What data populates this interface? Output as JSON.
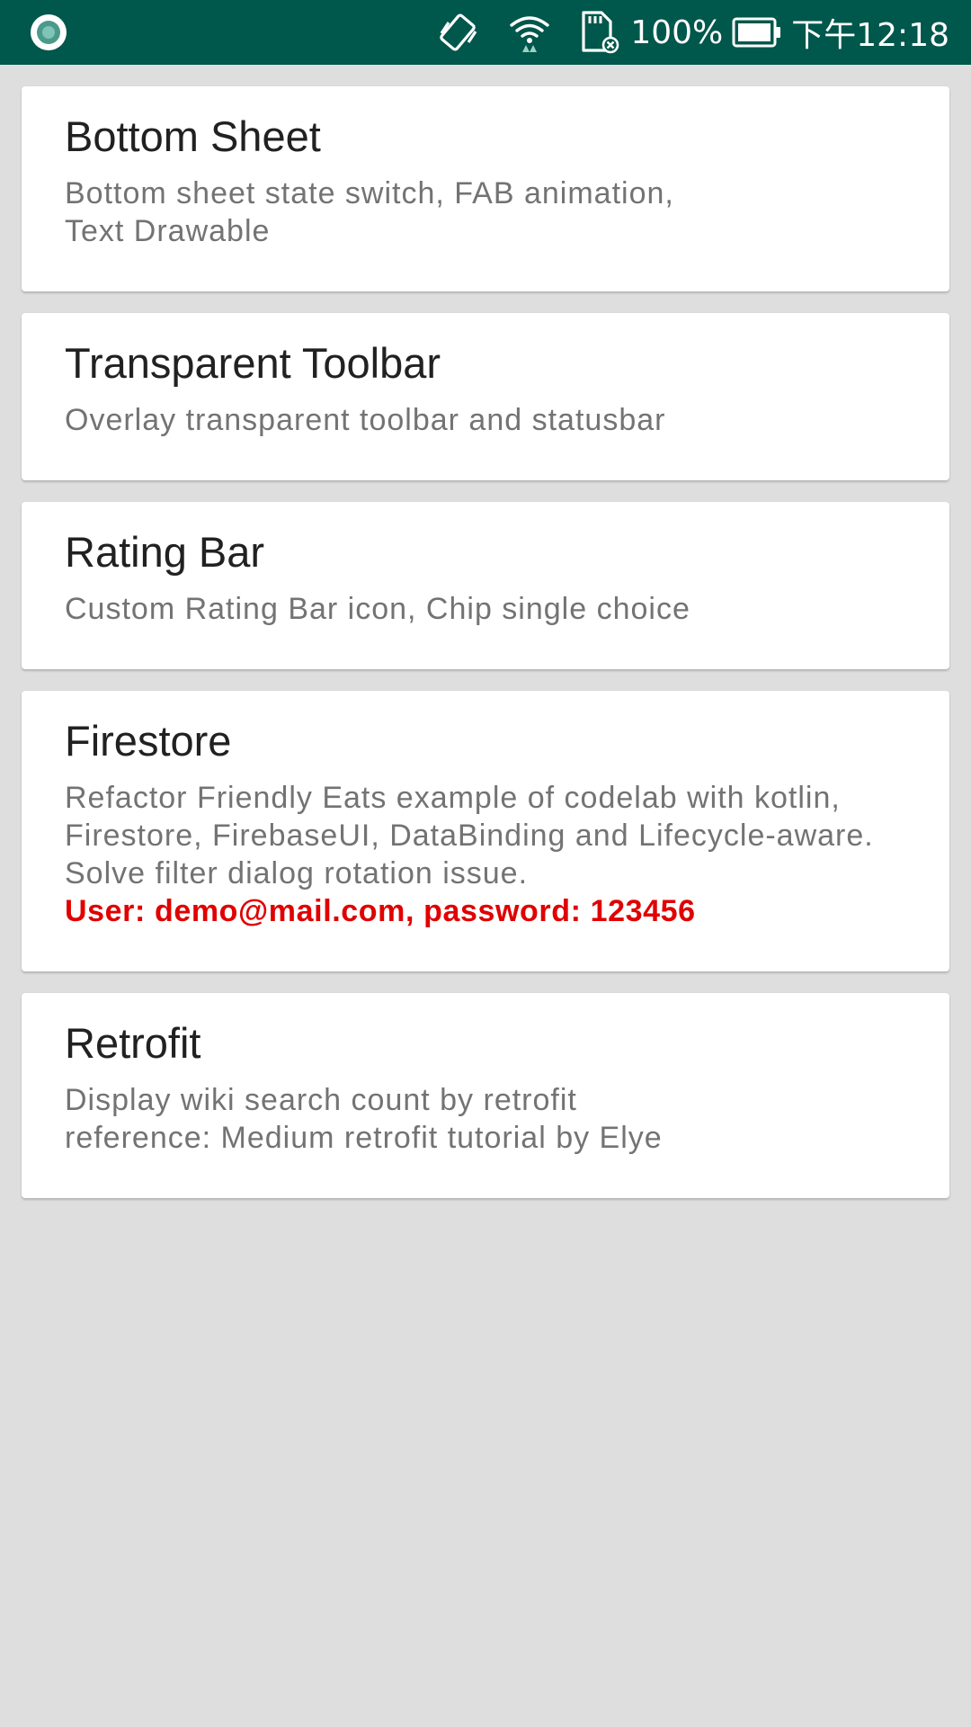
{
  "status_bar": {
    "background": "#00574b",
    "left_icon": "notification-circle-icon",
    "icons": [
      "vibrate-icon",
      "wifi-icon",
      "sd-card-icon",
      "battery-icon"
    ],
    "battery_percent": "100%",
    "time": "下午12:18"
  },
  "cards": [
    {
      "title": "Bottom Sheet",
      "lines": [
        "Bottom sheet state switch, FAB animation,",
        "Text Drawable"
      ],
      "note": ""
    },
    {
      "title": "Transparent Toolbar",
      "lines": [
        "Overlay transparent toolbar and statusbar"
      ],
      "note": ""
    },
    {
      "title": "Rating Bar",
      "lines": [
        "Custom Rating Bar icon, Chip single choice"
      ],
      "note": ""
    },
    {
      "title": "Firestore",
      "lines": [
        "Refactor Friendly Eats example of codelab with kotlin,",
        "Firestore, FirebaseUI, DataBinding and Lifecycle-aware.",
        "Solve filter dialog rotation issue."
      ],
      "note": "User: demo@mail.com, password: 123456"
    },
    {
      "title": "Retrofit",
      "lines": [
        "Display wiki search count by retrofit",
        "reference: Medium retrofit tutorial by Elye"
      ],
      "note": ""
    }
  ],
  "colors": {
    "accent_note": "#e00000",
    "title": "#212121",
    "description": "#737373",
    "page_background": "#dedede"
  }
}
